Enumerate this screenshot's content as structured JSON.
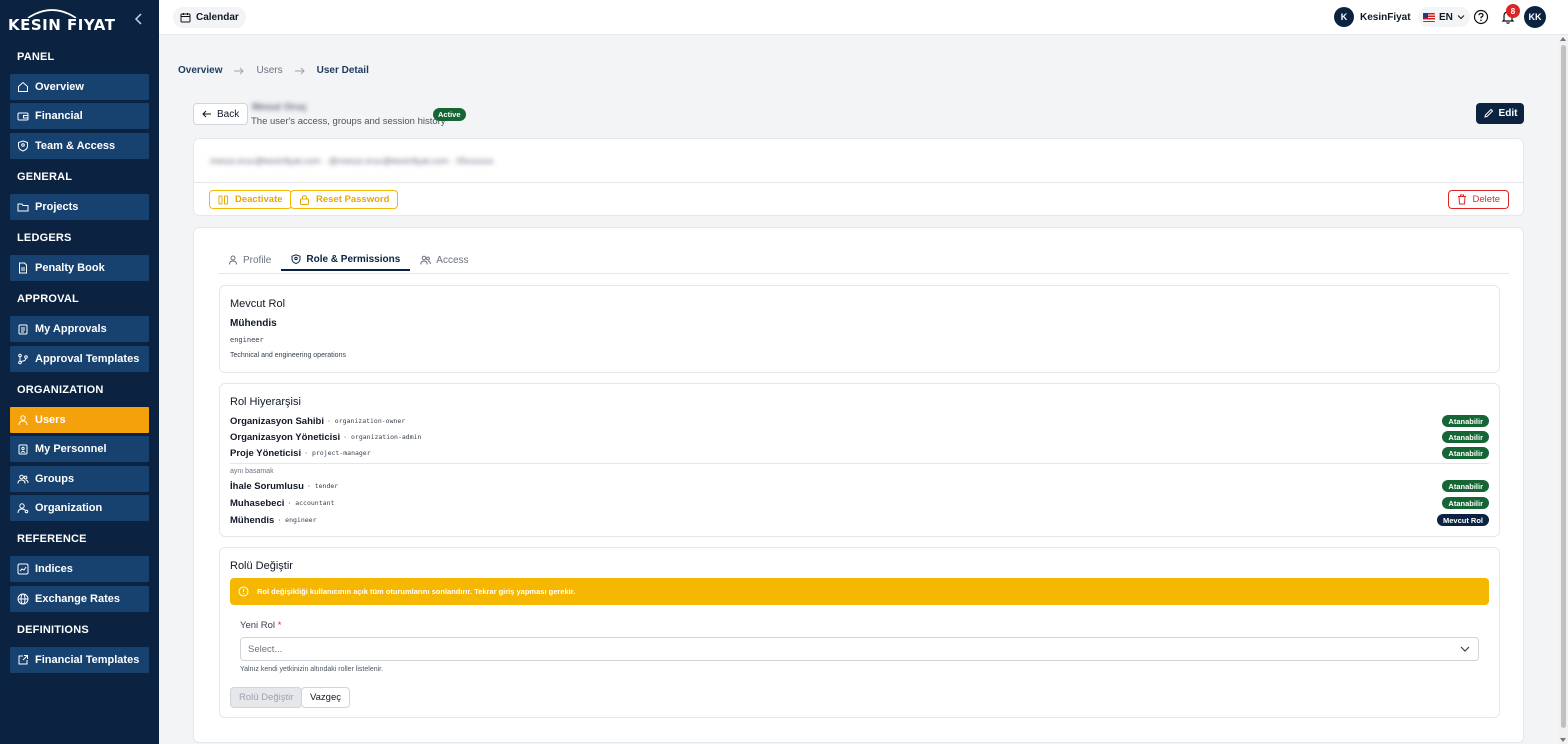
{
  "brand": {
    "logo_text": "KESIN FIYAT"
  },
  "sidebar": {
    "sections": [
      {
        "title": "PANEL",
        "items": [
          {
            "label": "Overview",
            "icon": "home-icon"
          },
          {
            "label": "Financial",
            "icon": "wallet-icon"
          },
          {
            "label": "Team & Access",
            "icon": "shield-user-icon"
          }
        ]
      },
      {
        "title": "GENERAL",
        "items": [
          {
            "label": "Projects",
            "icon": "folder-icon"
          }
        ]
      },
      {
        "title": "LEDGERS",
        "items": [
          {
            "label": "Penalty Book",
            "icon": "document-icon"
          }
        ]
      },
      {
        "title": "APPROVAL",
        "items": [
          {
            "label": "My Approvals",
            "icon": "clipboard-icon"
          },
          {
            "label": "Approval Templates",
            "icon": "git-branch-icon"
          }
        ]
      },
      {
        "title": "ORGANIZATION",
        "items": [
          {
            "label": "Users",
            "icon": "user-icon",
            "active": true
          },
          {
            "label": "My Personnel",
            "icon": "clipboard-user-icon"
          },
          {
            "label": "Groups",
            "icon": "users-icon"
          },
          {
            "label": "Organization",
            "icon": "user-cog-icon"
          }
        ]
      },
      {
        "title": "REFERENCE",
        "items": [
          {
            "label": "Indices",
            "icon": "chart-line-icon"
          },
          {
            "label": "Exchange Rates",
            "icon": "globe-icon"
          }
        ]
      },
      {
        "title": "DEFINITIONS",
        "items": [
          {
            "label": "Financial Templates",
            "icon": "external-doc-icon"
          }
        ]
      }
    ]
  },
  "topbar": {
    "calendar_label": "Calendar",
    "org_initial": "K",
    "org_name": "KesinFiyat",
    "language": "EN",
    "notification_count": "8",
    "user_initials": "KK"
  },
  "breadcrumb": {
    "items": [
      "Overview",
      "Users",
      "User Detail"
    ]
  },
  "header": {
    "back_label": "Back",
    "user_name": "Mesut Oruç",
    "subtitle": "The user's access, groups and session history",
    "status": "Active",
    "edit_label": "Edit"
  },
  "info": {
    "blurred_contact": "mesut.oruc@kesinfiyat.com · @mesut.oruc@kesinfiyat.com · 05xxxxxx",
    "deactivate_label": "Deactivate",
    "reset_password_label": "Reset Password",
    "delete_label": "Delete"
  },
  "tabs": [
    {
      "label": "Profile",
      "icon": "user-icon"
    },
    {
      "label": "Role & Permissions",
      "icon": "shield-icon",
      "active": true
    },
    {
      "label": "Access",
      "icon": "users-icon"
    }
  ],
  "current_role": {
    "title": "Mevcut Rol",
    "name": "Mühendis",
    "key": "engineer",
    "description": "Technical and engineering operations"
  },
  "hierarchy": {
    "title": "Rol Hiyerarşisi",
    "upper": [
      {
        "name": "Organizasyon Sahibi",
        "key": "organization-owner",
        "badge": "Atanabilir"
      },
      {
        "name": "Organizasyon Yöneticisi",
        "key": "organization-admin",
        "badge": "Atanabilir"
      },
      {
        "name": "Proje Yöneticisi",
        "key": "project-manager",
        "badge": "Atanabilir"
      }
    ],
    "same_level_label": "aynı basamak",
    "same": [
      {
        "name": "İhale Sorumlusu",
        "key": "tender",
        "badge": "Atanabilir"
      },
      {
        "name": "Muhasebeci",
        "key": "accountant",
        "badge": "Atanabilir"
      },
      {
        "name": "Mühendis",
        "key": "engineer",
        "badge": "Mevcut Rol"
      }
    ]
  },
  "change_role": {
    "title": "Rolü Değiştir",
    "alert": "Rol değişikliği kullanıcının açık tüm oturumlarını sonlandırır. Tekrar giriş yapması gerekir.",
    "field_label": "Yeni Rol",
    "required_mark": "*",
    "placeholder": "Select...",
    "help": "Yalnız kendi yetkinizin altındaki roller listelenir.",
    "submit_label": "Rolü Değiştir",
    "cancel_label": "Vazgeç"
  },
  "colors": {
    "sidebar_bg": "#0b2341",
    "nav_item_bg": "#17416f",
    "active_nav": "#f5a10c",
    "success": "#166534",
    "warning": "#f5b700",
    "danger": "#dc2626"
  }
}
